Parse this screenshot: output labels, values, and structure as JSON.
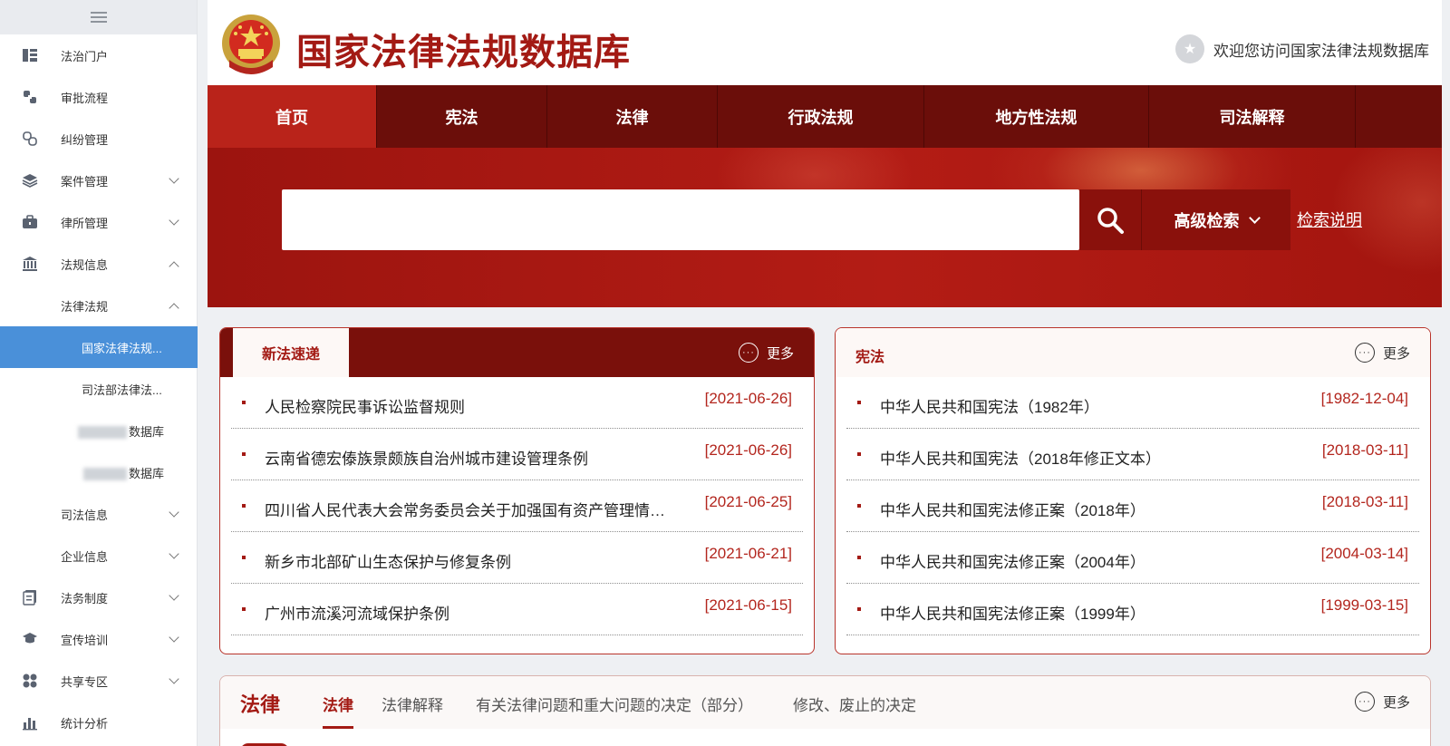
{
  "sidebar": {
    "items": [
      {
        "label": "法治门户",
        "icon": "dashboard-icon",
        "level": 1
      },
      {
        "label": "审批流程",
        "icon": "workflow-icon",
        "level": 1
      },
      {
        "label": "纠纷管理",
        "icon": "link-icon",
        "level": 1
      },
      {
        "label": "案件管理",
        "icon": "layers-icon",
        "level": 1,
        "expand": "down"
      },
      {
        "label": "律所管理",
        "icon": "briefcase-icon",
        "level": 1,
        "expand": "down"
      },
      {
        "label": "法规信息",
        "icon": "bank-icon",
        "level": 1,
        "expand": "up"
      },
      {
        "label": "法律法规",
        "level": 2,
        "expand": "up"
      },
      {
        "label": "国家法律法规...",
        "level": 3,
        "active": true
      },
      {
        "label": "司法部法律法...",
        "level": 3
      },
      {
        "label": "数据库",
        "level": 3,
        "blurred": true
      },
      {
        "label": "数据库",
        "level": 3,
        "blurred": true
      },
      {
        "label": "司法信息",
        "level": 2,
        "expand": "down"
      },
      {
        "label": "企业信息",
        "level": 2,
        "expand": "down"
      },
      {
        "label": "法务制度",
        "icon": "document-icon",
        "level": 1,
        "expand": "down"
      },
      {
        "label": "宣传培训",
        "icon": "graduation-cap-icon",
        "level": 1,
        "expand": "down"
      },
      {
        "label": "共享专区",
        "icon": "grid-icon",
        "level": 1,
        "expand": "down"
      },
      {
        "label": "统计分析",
        "icon": "bar-chart-icon",
        "level": 1
      }
    ]
  },
  "header": {
    "title": "国家法律法规数据库",
    "welcome": "欢迎您访问国家法律法规数据库"
  },
  "nav": {
    "items": [
      {
        "label": "首页",
        "active": true
      },
      {
        "label": "宪法"
      },
      {
        "label": "法律"
      },
      {
        "label": "行政法规"
      },
      {
        "label": "地方性法规"
      },
      {
        "label": "司法解释"
      },
      {
        "label": ""
      }
    ]
  },
  "search": {
    "placeholder": "",
    "advanced_label": "高级检索",
    "help_label": "检索说明"
  },
  "new_laws": {
    "tab_label": "新法速递",
    "more_label": "更多",
    "items": [
      {
        "title": "人民检察院民事诉讼监督规则",
        "date": "[2021-06-26]"
      },
      {
        "title": "云南省德宏傣族景颇族自治州城市建设管理条例",
        "date": "[2021-06-26]"
      },
      {
        "title": "四川省人民代表大会常务委员会关于加强国有资产管理情况监督的决定",
        "date": "[2021-06-25]"
      },
      {
        "title": "新乡市北部矿山生态保护与修复条例",
        "date": "[2021-06-21]"
      },
      {
        "title": "广州市流溪河流域保护条例",
        "date": "[2021-06-15]"
      }
    ]
  },
  "constitution": {
    "title": "宪法",
    "more_label": "更多",
    "items": [
      {
        "title": "中华人民共和国宪法（1982年）",
        "date": "[1982-12-04]"
      },
      {
        "title": "中华人民共和国宪法（2018年修正文本）",
        "date": "[2018-03-11]"
      },
      {
        "title": "中华人民共和国宪法修正案（2018年）",
        "date": "[2018-03-11]"
      },
      {
        "title": "中华人民共和国宪法修正案（2004年）",
        "date": "[2004-03-14]"
      },
      {
        "title": "中华人民共和国宪法修正案（1999年）",
        "date": "[1999-03-15]"
      }
    ]
  },
  "law_section": {
    "title": "法律",
    "more_label": "更多",
    "tabs": [
      {
        "label": "法律",
        "active": true
      },
      {
        "label": "法律解释"
      },
      {
        "label": "有关法律问题和重大问题的决定（部分）"
      },
      {
        "label": "修改、废止的决定"
      }
    ]
  },
  "colors": {
    "primary": "#a31a14",
    "nav_bg": "#6b0e0a",
    "active_nav": "#b9231a",
    "sidebar_active": "#4a90d9"
  }
}
